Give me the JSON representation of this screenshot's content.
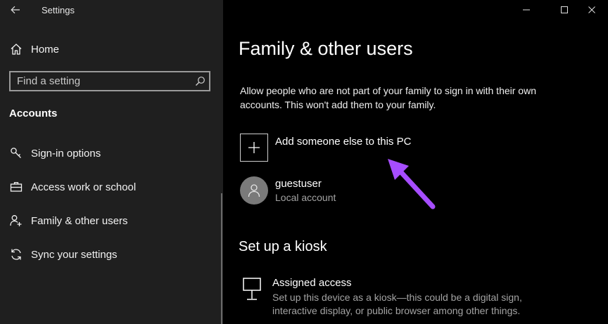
{
  "window": {
    "title": "Settings",
    "back_icon": "arrow-left-icon",
    "controls": [
      "minimize-icon",
      "maximize-icon",
      "close-icon"
    ]
  },
  "sidebar": {
    "home_label": "Home",
    "search": {
      "placeholder": "Find a setting",
      "value": ""
    },
    "section_label": "Accounts",
    "items": [
      {
        "label": "Sign-in options",
        "icon": "key-icon"
      },
      {
        "label": "Access work or school",
        "icon": "briefcase-icon"
      },
      {
        "label": "Family & other users",
        "icon": "add-person-icon"
      },
      {
        "label": "Sync your settings",
        "icon": "sync-icon"
      }
    ]
  },
  "main": {
    "title": "Family & other users",
    "description": "Allow people who are not part of your family to sign in with their own accounts. This won't add them to your family.",
    "add_label": "Add someone else to this PC",
    "user": {
      "name": "guestuser",
      "type": "Local account"
    },
    "kiosk_heading": "Set up a kiosk",
    "assigned_access": {
      "title": "Assigned access",
      "description": "Set up this device as a kiosk—this could be a digital sign, interactive display, or public browser among other things."
    }
  },
  "colors": {
    "sidebar_bg": "#1f1f1f",
    "main_bg": "#000000",
    "annotation_arrow": "#a64dff"
  }
}
